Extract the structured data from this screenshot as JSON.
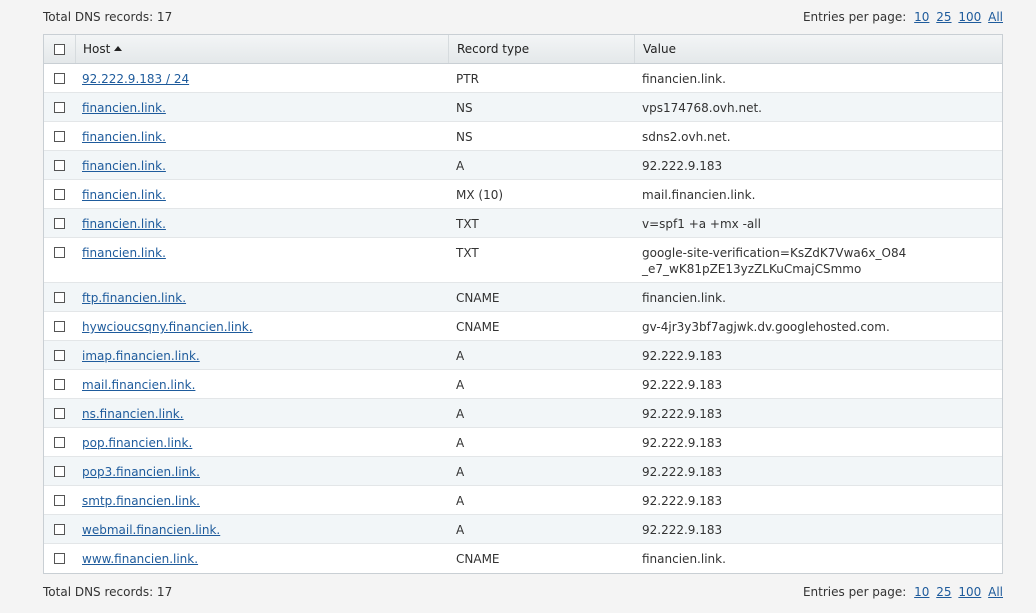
{
  "summary": {
    "total_label": "Total DNS records: 17",
    "entries_label": "Entries per page:",
    "page_sizes": [
      "10",
      "25",
      "100",
      "All"
    ]
  },
  "table": {
    "columns": {
      "host": "Host",
      "record_type": "Record type",
      "value": "Value"
    },
    "rows": [
      {
        "host": "92.222.9.183 / 24",
        "type": "PTR",
        "value": "financien.link."
      },
      {
        "host": "financien.link.",
        "type": "NS",
        "value": "vps174768.ovh.net."
      },
      {
        "host": "financien.link.",
        "type": "NS",
        "value": "sdns2.ovh.net."
      },
      {
        "host": "financien.link.",
        "type": "A",
        "value": "92.222.9.183"
      },
      {
        "host": "financien.link.",
        "type": "MX (10)",
        "value": "mail.financien.link."
      },
      {
        "host": "financien.link.",
        "type": "TXT",
        "value": "v=spf1 +a +mx -all"
      },
      {
        "host": "financien.link.",
        "type": "TXT",
        "value": "google-site-verification=KsZdK7Vwa6x_O84",
        "value_line2": "_e7_wK81pZE13yzZLKuCmajCSmmo"
      },
      {
        "host": "ftp.financien.link.",
        "type": "CNAME",
        "value": "financien.link."
      },
      {
        "host": "hywcioucsqny.financien.link.",
        "type": "CNAME",
        "value": "gv-4jr3y3bf7agjwk.dv.googlehosted.com."
      },
      {
        "host": "imap.financien.link.",
        "type": "A",
        "value": "92.222.9.183"
      },
      {
        "host": "mail.financien.link.",
        "type": "A",
        "value": "92.222.9.183"
      },
      {
        "host": "ns.financien.link.",
        "type": "A",
        "value": "92.222.9.183"
      },
      {
        "host": "pop.financien.link.",
        "type": "A",
        "value": "92.222.9.183"
      },
      {
        "host": "pop3.financien.link.",
        "type": "A",
        "value": "92.222.9.183"
      },
      {
        "host": "smtp.financien.link.",
        "type": "A",
        "value": "92.222.9.183"
      },
      {
        "host": "webmail.financien.link.",
        "type": "A",
        "value": "92.222.9.183"
      },
      {
        "host": "www.financien.link.",
        "type": "CNAME",
        "value": "financien.link."
      }
    ]
  },
  "colors": {
    "link": "#1e5b9c",
    "alt_row": "#f2f6f8",
    "border": "#c9cfd4"
  }
}
